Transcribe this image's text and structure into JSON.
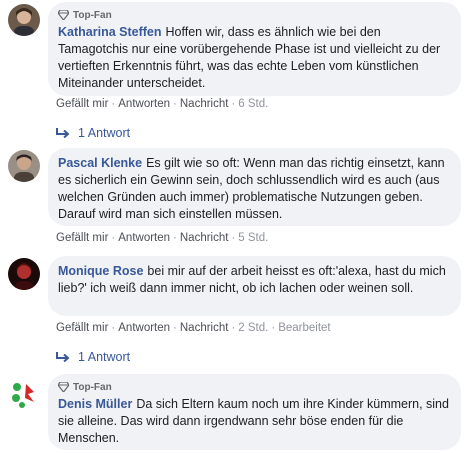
{
  "badge_label": "Top-Fan",
  "reply_arrow_color": "#385898",
  "comments": [
    {
      "author": "Katharina Steffen",
      "text": "Hoffen wir, dass es ähnlich wie bei den Tamagotchis nur eine vorübergehende Phase ist und vielleicht zu der vertieften Erkenntnis führt, was das echte Leben vom künstlichen Miteinander unterscheidet.",
      "top_fan": true,
      "actions": [
        "Gefällt mir",
        "Antworten",
        "Nachricht"
      ],
      "time": "6 Std.",
      "replies_label": "1 Antwort"
    },
    {
      "author": "Pascal Klenke",
      "text": "Es gilt wie so oft: Wenn man das richtig einsetzt, kann es sicherlich ein Gewinn sein, doch schlussendlich wird es auch (aus welchen Gründen auch immer) problematische Nutzungen geben. Darauf wird man sich einstellen müssen.",
      "top_fan": false,
      "actions": [
        "Gefällt mir",
        "Antworten",
        "Nachricht"
      ],
      "time": "5 Std."
    },
    {
      "author": "Monique Rose",
      "text": "bei mir auf der arbeit heisst es oft:'alexa, hast du mich lieb?' ich weiß dann immer nicht, ob ich lachen oder weinen soll.",
      "top_fan": false,
      "actions": [
        "Gefällt mir",
        "Antworten",
        "Nachricht"
      ],
      "time": "2 Std.",
      "edited": "Bearbeitet",
      "replies_label": "1 Antwort"
    },
    {
      "author": "Denis Müller",
      "text": "Da sich Eltern kaum noch um ihre Kinder kümmern, sind sie alleine. Das wird dann irgendwann sehr böse enden für die Menschen.",
      "top_fan": true
    }
  ]
}
